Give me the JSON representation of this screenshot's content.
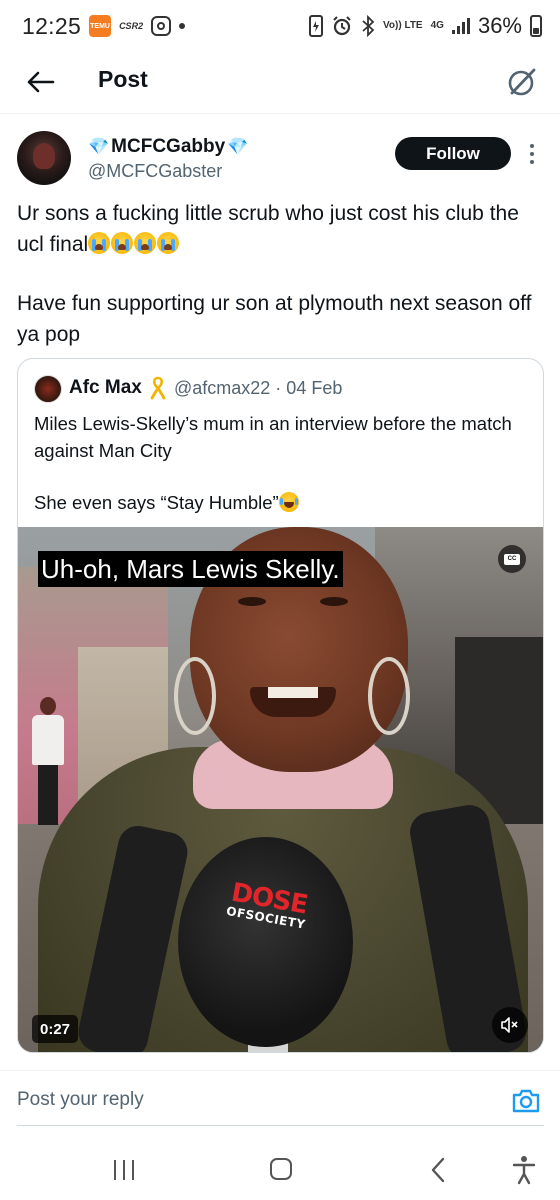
{
  "status_bar": {
    "time": "12:25",
    "notif_temu": "TEMU",
    "notif_csr": "CSR2",
    "network_volte": "Vo)) LTE",
    "network_4g": "4G",
    "battery": "36%"
  },
  "header": {
    "title": "Post",
    "back_icon": "arrow-left-icon",
    "grok_icon": "grok-icon"
  },
  "tweet": {
    "author_name": "MCFCGabby",
    "author_emoji_left": "💎",
    "author_emoji_right": "💎",
    "author_handle": "@MCFCGabster",
    "follow_label": "Follow",
    "text_1": "Ur sons a fucking little scrub who just cost his club the ucl final",
    "text_1_emoji": "😭😭😭😭",
    "text_2": "Have fun supporting ur son at plymouth next season off ya pop"
  },
  "quote": {
    "author_name": "Afc Max",
    "ribbon_icon": "yellow-ribbon-icon",
    "handle_date": "@afcmax22 · 04 Feb",
    "text_1": "Miles Lewis-Skelly’s mum in an interview before the match against Man City",
    "text_2": "She even says “Stay Humble”",
    "text_2_emoji": "😂",
    "video": {
      "caption": "Uh-oh, Mars Lewis Skelly.",
      "duration": "0:27",
      "cc_label": "CC",
      "mic_logo_top": "DOSE",
      "mic_logo_bottom": "OFSOCIETY"
    }
  },
  "reply": {
    "placeholder": "Post your reply",
    "camera_icon": "camera-icon"
  },
  "nav": {
    "recents_icon": "recents-icon",
    "home_icon": "home-icon",
    "back_icon": "back-chevron-icon",
    "accessibility_icon": "accessibility-icon"
  },
  "colors": {
    "text_primary": "#0f1419",
    "text_secondary": "#536471",
    "follow_bg": "#0f1419",
    "accent_blue": "#1d9bf0",
    "border": "#cfd9de"
  }
}
